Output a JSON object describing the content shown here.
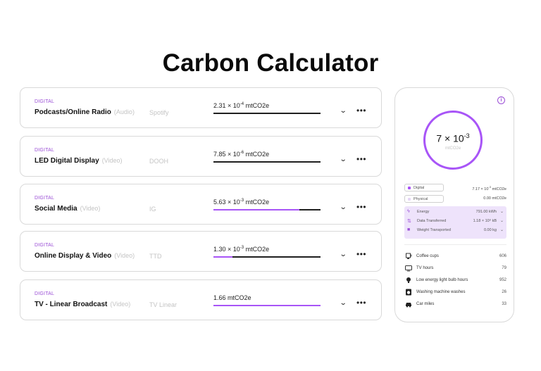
{
  "title": "Carbon Calculator",
  "colors": {
    "accent": "#a855f7",
    "category": "#9b4fd6",
    "track": "#1f1f1f"
  },
  "rows": [
    {
      "category": "DIGITAL",
      "name": "Podcasts/Online Radio",
      "type": "(Audio)",
      "platform": "Spotify",
      "value_mantissa": "2.31 × 10",
      "value_exp": "-4",
      "value_unit": " mtCO2e",
      "progress": 0.0
    },
    {
      "category": "DIGITAL",
      "name": "LED Digital Display",
      "type": "(Video)",
      "platform": "DOOH",
      "value_mantissa": "7.85 × 10",
      "value_exp": "-6",
      "value_unit": " mtCO2e",
      "progress": 0.0
    },
    {
      "category": "DIGITAL",
      "name": "Social Media",
      "type": "(Video)",
      "platform": "IG",
      "value_mantissa": "5.63 × 10",
      "value_exp": "-3",
      "value_unit": " mtCO2e",
      "progress": 0.8
    },
    {
      "category": "DIGITAL",
      "name": "Online Display & Video",
      "type": "(Video)",
      "platform": "TTD",
      "value_mantissa": "1.30 × 10",
      "value_exp": "-3",
      "value_unit": " mtCO2e",
      "progress": 0.18
    },
    {
      "category": "DIGITAL",
      "name": "TV - Linear Broadcast",
      "type": "(Video)",
      "platform": "TV Linear",
      "value_mantissa": "1.66 mtCO2e",
      "value_exp": "",
      "value_unit": "",
      "progress": 1.0
    }
  ],
  "summary": {
    "total_mantissa": "7 × 10",
    "total_exp": "-3",
    "total_unit": "mtCO2e",
    "digital": {
      "label": "Digital",
      "value_mantissa": "7.17 × 10",
      "value_exp": "-3",
      "value_unit": " mtCO2e"
    },
    "physical": {
      "label": "Physical",
      "value": "0.00 mtCO2e"
    },
    "breakdown": [
      {
        "label": "Energy",
        "value": "791.00 kWh",
        "icon": "lightning-icon"
      },
      {
        "label": "Data Transferred",
        "value": "1.18 × 10⁹ kB",
        "icon": "transfer-icon"
      },
      {
        "label": "Weight Transported",
        "value": "0.00 kg",
        "icon": "truck-icon"
      }
    ],
    "equivalents": [
      {
        "label": "Coffee cups",
        "value": "606",
        "icon": "coffee-icon"
      },
      {
        "label": "TV hours",
        "value": "79",
        "icon": "tv-icon"
      },
      {
        "label": "Low energy light bulb hours",
        "value": "952",
        "icon": "lightbulb-icon"
      },
      {
        "label": "Washing machine washes",
        "value": "26",
        "icon": "washing-machine-icon"
      },
      {
        "label": "Car miles",
        "value": "33",
        "icon": "car-icon"
      }
    ]
  }
}
